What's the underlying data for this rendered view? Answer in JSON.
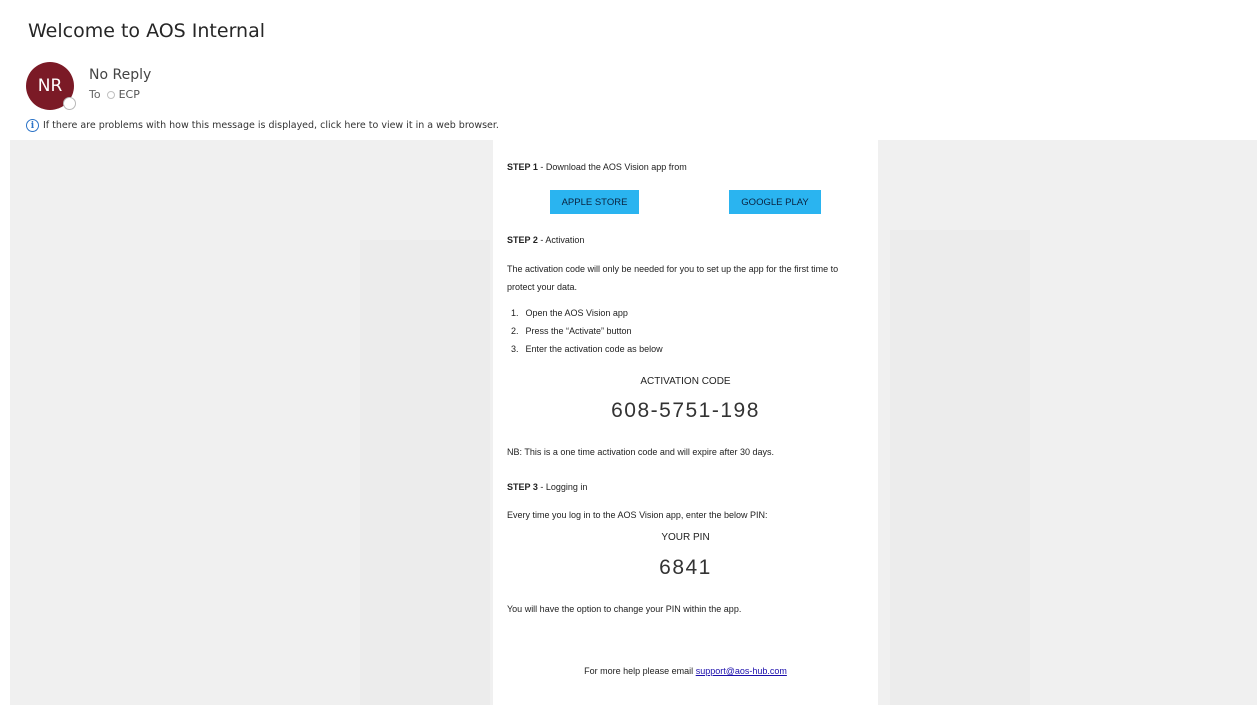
{
  "message": {
    "subject": "Welcome to AOS Internal",
    "sender": {
      "initials": "NR",
      "name": "No Reply"
    },
    "to_label": "To",
    "recipient": "ECP",
    "infobar_text": "If there are problems with how this message is displayed, click here to view it in a web browser."
  },
  "email": {
    "step1": {
      "heading": "STEP 1",
      "text": " - Download the AOS Vision app from"
    },
    "apple_button": "APPLE STORE",
    "google_button": "GOOGLE PLAY",
    "step2": {
      "heading": "STEP 2",
      "text": " - Activation"
    },
    "activation_intro": "The activation code will only be needed for you to set up the app for the first time to protect your data.",
    "instructions": [
      {
        "num": "1.",
        "text": "Open the AOS Vision app"
      },
      {
        "num": "2.",
        "text": "Press the “Activate” button"
      },
      {
        "num": "3.",
        "text": "Enter the activation code as below"
      }
    ],
    "code_label": "ACTIVATION CODE",
    "code_value": "608-5751-198",
    "nb_text": "NB: This is a one time activation code and will expire after 30 days.",
    "step3": {
      "heading": "STEP 3",
      "text": " - Logging in"
    },
    "login_intro": "Every time you log in to the AOS Vision app, enter the below PIN:",
    "pin_label": "YOUR PIN",
    "pin_value": "6841",
    "change_pin": "You will have the option to change your PIN within the app.",
    "help_text": "For more help please email ",
    "help_email": "support@aos-hub.com"
  },
  "colors": {
    "avatar": "#7b1a26",
    "store_button": "#2ab4f0",
    "link": "#1a0dab",
    "info_icon": "#2a72c7",
    "canvas_background": "#f0f0f0"
  },
  "icons": {
    "info": "info-icon",
    "presence": "presence-status-icon"
  }
}
